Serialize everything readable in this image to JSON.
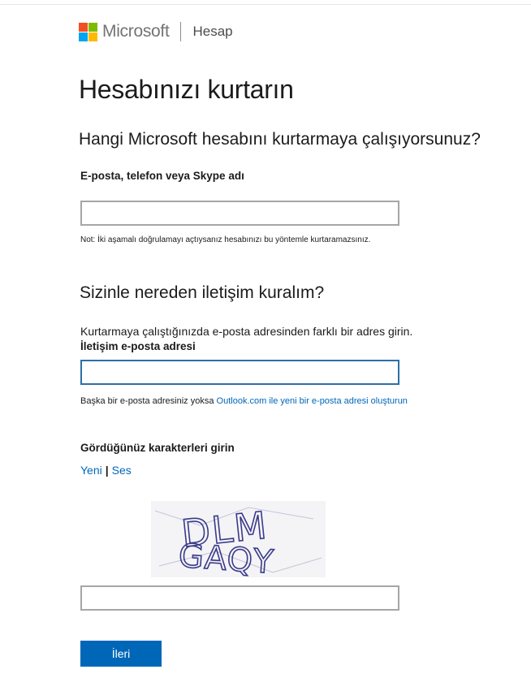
{
  "header": {
    "brand": "Microsoft",
    "section": "Hesap",
    "logo_colors": [
      "#f25022",
      "#7fba00",
      "#00a4ef",
      "#ffb900"
    ]
  },
  "page_title": "Hesabınızı kurtarın",
  "subtitle": "Hangi Microsoft hesabını kurtarmaya çalışıyorsunuz?",
  "account_field": {
    "label": "E-posta, telefon veya Skype adı",
    "value": "",
    "note": "Not: İki aşamalı doğrulamayı açtıysanız hesabınızı bu yöntemle kurtaramazsınız."
  },
  "contact_section": {
    "heading": "Sizinle nereden iletişim kuralım?",
    "instruction": "Kurtarmaya çalıştığınızda e-posta adresinden farklı bir adres girin.",
    "label": "İletişim e-posta adresi",
    "value": "",
    "help_prefix": "Başka bir e-posta adresiniz yoksa ",
    "help_link": "Outlook.com ile yeni bir e-posta adresi oluşturun"
  },
  "captcha": {
    "label": "Gördüğünüz karakterleri girin",
    "new_link": "Yeni",
    "separator": "|",
    "audio_link": "Ses",
    "image_text_line1": "DLM",
    "image_text_line2": "GAQY",
    "value": ""
  },
  "next_button": "İleri",
  "colors": {
    "accent": "#0067b8",
    "focus_border": "#2c6fa8",
    "field_border": "#a6a6a6"
  }
}
